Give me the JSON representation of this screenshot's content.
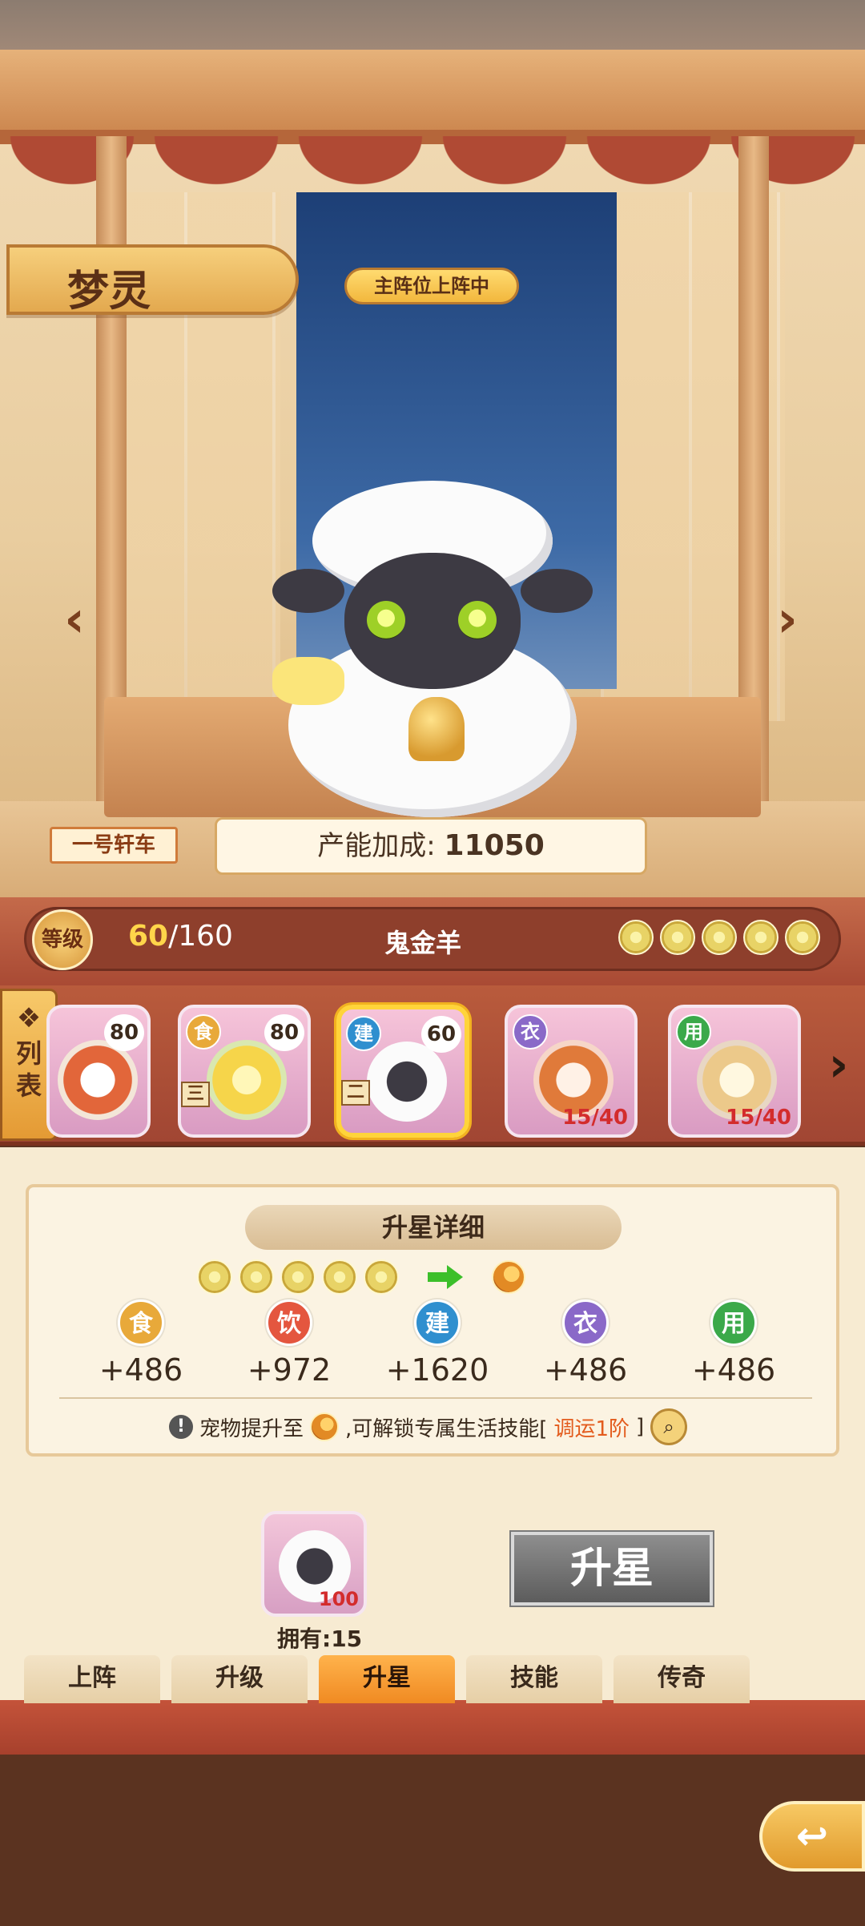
{
  "pet": {
    "name": "梦灵",
    "status_badge": "主阵位上阵中",
    "species": "鬼金羊"
  },
  "scene": {
    "carriage_tag": "一号轩车",
    "production_label": "产能加成:",
    "production_value": "11050"
  },
  "level": {
    "badge_label": "等级",
    "current": "60",
    "max": "/160",
    "star_count": 5
  },
  "list_tab": {
    "icon": "❖",
    "label": "列表"
  },
  "cards": [
    {
      "type": "",
      "level": "80",
      "tier": "",
      "progress": ""
    },
    {
      "type": "食",
      "level": "80",
      "tier": "三",
      "progress": ""
    },
    {
      "type": "建",
      "level": "60",
      "tier": "二",
      "progress": ""
    },
    {
      "type": "衣",
      "level": "",
      "tier": "",
      "progress": "15/40"
    },
    {
      "type": "用",
      "level": "",
      "tier": "",
      "progress": "15/40"
    }
  ],
  "detail": {
    "title": "升星详细",
    "attributes": [
      {
        "label": "食",
        "value": "+486",
        "color": "#e8a93a"
      },
      {
        "label": "饮",
        "value": "+972",
        "color": "#e4563f"
      },
      {
        "label": "建",
        "value": "+1620",
        "color": "#2f8fcf"
      },
      {
        "label": "衣",
        "value": "+486",
        "color": "#8a69c8"
      },
      {
        "label": "用",
        "value": "+486",
        "color": "#3ba94a"
      }
    ],
    "unlock_prefix": "宠物提升至",
    "unlock_mid": ",可解锁专属生活技能[",
    "unlock_skill": "调运1阶",
    "unlock_suffix": "]"
  },
  "material": {
    "quantity": "100",
    "owned": "拥有:15"
  },
  "starup_button": "升星",
  "tabs": [
    {
      "label": "上阵",
      "active": false
    },
    {
      "label": "升级",
      "active": false
    },
    {
      "label": "升星",
      "active": true
    },
    {
      "label": "技能",
      "active": false
    },
    {
      "label": "传奇",
      "active": false
    }
  ],
  "colors": {
    "accent": "#f08a22",
    "brand_red": "#a94a34",
    "gold": "#e3a94f"
  }
}
